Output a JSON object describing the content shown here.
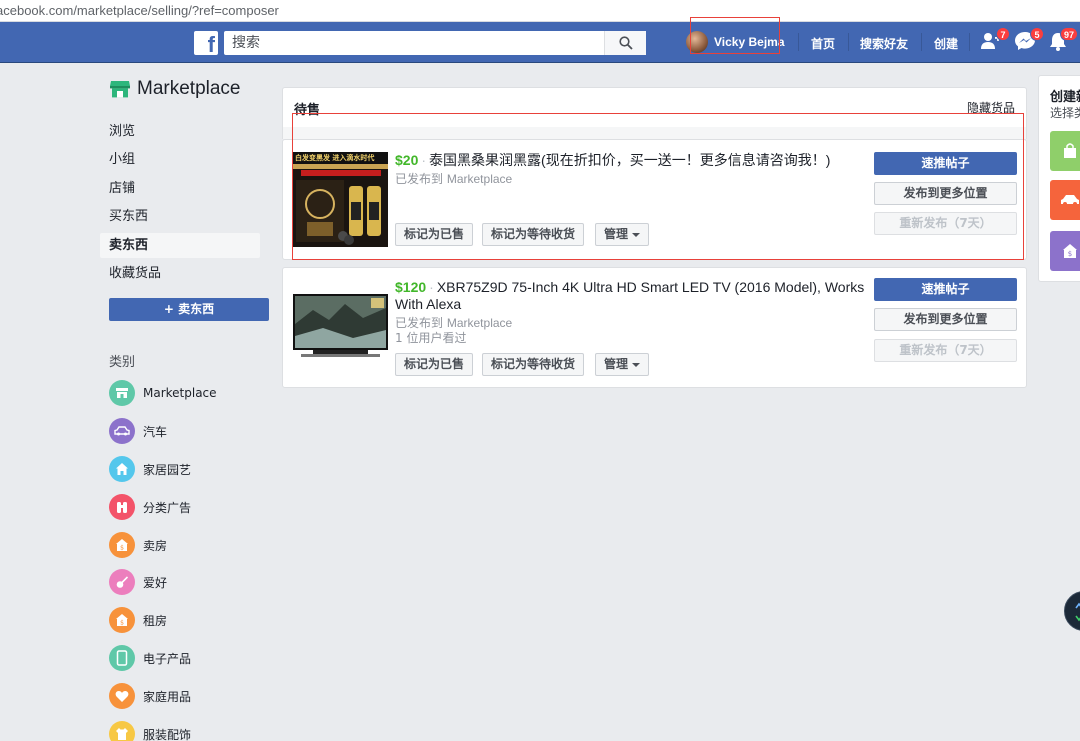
{
  "browser": {
    "url": "acebook.com/marketplace/selling/?ref=composer"
  },
  "topbar": {
    "logo": "f",
    "search_placeholder": "搜索",
    "profile_name": "Vicky Bejma",
    "nav": {
      "home": "首页",
      "find_friends": "搜索好友",
      "create": "创建"
    },
    "badges": {
      "friend_requests": "7",
      "messages": "5",
      "notifications": "97"
    }
  },
  "sidebar": {
    "title": "Marketplace",
    "items": [
      "浏览",
      "小组",
      "店铺",
      "买东西",
      "卖东西",
      "收藏货品"
    ],
    "active_item": "卖东西",
    "sell_button": "+ 卖东西",
    "categories_heading": "类别",
    "categories": [
      {
        "label": "Marketplace",
        "icon": "storefront-icon",
        "color": "#5fc8a8"
      },
      {
        "label": "汽车",
        "icon": "car-icon",
        "color": "#8c72cb"
      },
      {
        "label": "家居园艺",
        "icon": "house-icon",
        "color": "#54c7ec"
      },
      {
        "label": "分类广告",
        "icon": "binoculars-icon",
        "color": "#f35369"
      },
      {
        "label": "卖房",
        "icon": "house-sale-icon",
        "color": "#f7923b"
      },
      {
        "label": "爱好",
        "icon": "guitar-icon",
        "color": "#ec7ebd"
      },
      {
        "label": "租房",
        "icon": "house-rent-icon",
        "color": "#f7923b"
      },
      {
        "label": "电子产品",
        "icon": "phone-icon",
        "color": "#5fc8a8"
      },
      {
        "label": "家庭用品",
        "icon": "heart-icon",
        "color": "#f7923b"
      },
      {
        "label": "服装配饰",
        "icon": "clothing-icon",
        "color": "#f7c844"
      }
    ]
  },
  "main": {
    "header_title": "待售",
    "hide_items_link": "隐藏货品",
    "listings": [
      {
        "price": "$20",
        "title": "泰国黑桑果润黑露(现在折扣价，买一送一！更多信息请咨询我！)",
        "posted_to": "已发布到",
        "posted_to_place": "Marketplace",
        "views": "",
        "thumbnail_text": "白发变黑发 进入滴水时代",
        "actions": {
          "mark_sold": "标记为已售",
          "mark_pending": "标记为等待收货",
          "manage": "管理"
        },
        "right_actions": {
          "boost": "速推帖子",
          "share_more": "发布到更多位置",
          "renew": "重新发布（7天）"
        }
      },
      {
        "price": "$120",
        "title": "XBR75Z9D 75-Inch 4K Ultra HD Smart LED TV (2016 Model), Works With Alexa",
        "posted_to": "已发布到",
        "posted_to_place": "Marketplace",
        "views": "1 位用户看过",
        "actions": {
          "mark_sold": "标记为已售",
          "mark_pending": "标记为等待收货",
          "manage": "管理"
        },
        "right_actions": {
          "boost": "速推帖子",
          "share_more": "发布到更多位置",
          "renew": "重新发布（7天）"
        }
      }
    ]
  },
  "right_panel": {
    "title": "创建新",
    "subtitle": "选择类",
    "tiles": [
      {
        "icon": "shopping-bag-icon",
        "color": "#8fcf6a"
      },
      {
        "icon": "car-icon",
        "color": "#f5643c"
      },
      {
        "icon": "house-sale-icon",
        "color": "#8c72cb"
      }
    ]
  },
  "colors": {
    "fb_blue": "#4267b2",
    "price_green": "#42b72a",
    "annotation_red": "#e8413a"
  }
}
